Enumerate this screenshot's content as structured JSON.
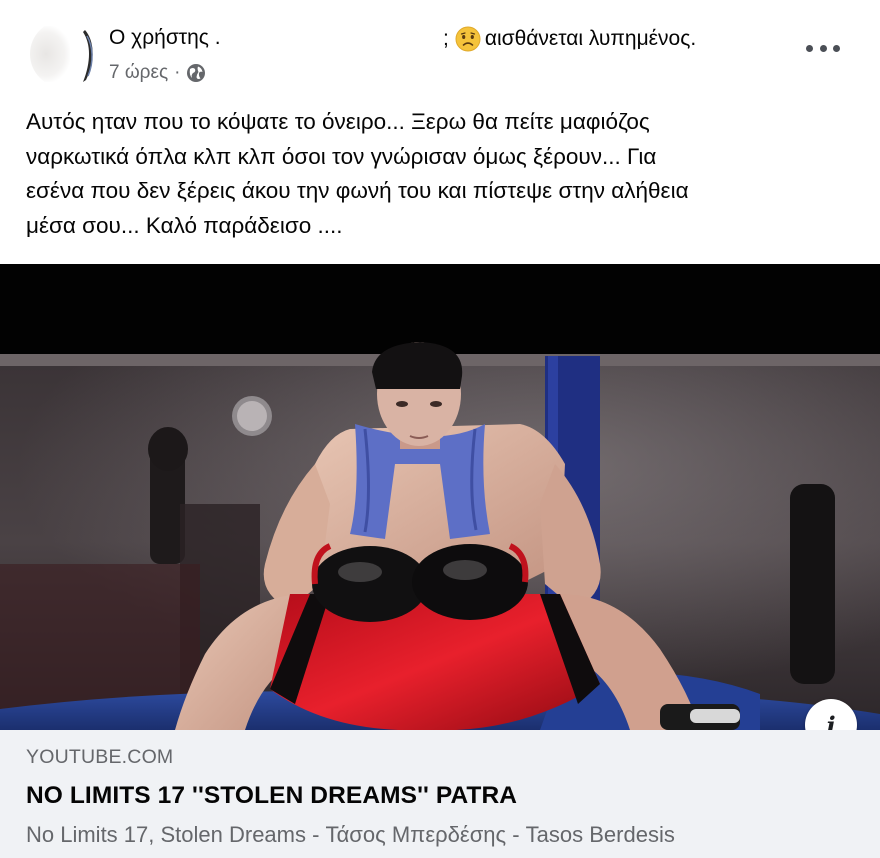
{
  "post": {
    "author": "Ο χρήστης .",
    "feeling_prefix": ";",
    "feeling_icon": "sad-face-emoji",
    "feeling_text": "αισθάνεται λυπημένος.",
    "timestamp": "7 ώρες",
    "separator": "·",
    "audience_icon": "globe-icon",
    "more_icon": "more-options-icon",
    "text_lines": [
      "Αυτός ηταν που το κόψατε το όνειρο... Ξερω θα πείτε μαφιόζος",
      "ναρκωτικά όπλα κλπ κλπ όσοι τον γνώρισαν όμως ξέρουν... Για",
      "εσένα που δεν ξέρεις άκου την φωνή του και πίστεψε στην αλήθεια",
      "μέσα σου... Καλό παράδεισο ...."
    ]
  },
  "link_preview": {
    "domain": "YOUTUBE.COM",
    "title": "NO LIMITS 17 ''STOLEN DREAMS'' PATRA",
    "description": "No Limits 17, Stolen Dreams - Τάσος Μπερδέσης - Tasos Berdesis",
    "info_label": "i"
  },
  "colors": {
    "text_primary": "#050505",
    "text_secondary": "#65676b",
    "link_background": "#f0f2f5",
    "emoji_yellow": "#f5c33b"
  }
}
